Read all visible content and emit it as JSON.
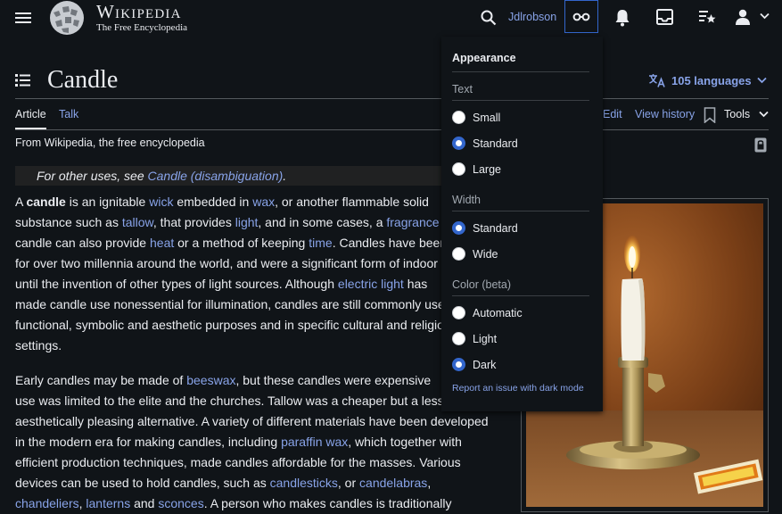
{
  "header": {
    "wordmark_title": "Wikipedia",
    "wordmark_tagline": "The Free Encyclopedia",
    "username": "Jdlrobson"
  },
  "page": {
    "title": "Candle",
    "languages_label": "105 languages",
    "tabs": {
      "article": "Article",
      "talk": "Talk",
      "edit": "Edit",
      "history": "View history",
      "tools": "Tools"
    },
    "tagline": "From Wikipedia, the free encyclopedia",
    "hatnote_prefix": "For other uses, see ",
    "hatnote_link": "Candle (disambiguation)",
    "hatnote_suffix": "."
  },
  "para1": {
    "l1a": "A ",
    "l1b": "candle",
    "l1c": " is an ignitable ",
    "l1d": "wick",
    "l1e": " embedded in ",
    "l1f": "wax",
    "l1g": ", or another flammable solid",
    "l2a": "substance such as ",
    "l2b": "tallow",
    "l2c": ", that provides ",
    "l2d": "light",
    "l2e": ", and in some cases, a ",
    "l2f": "fragrance",
    "l3a": "candle can also provide ",
    "l3b": "heat",
    "l3c": " or a method of keeping ",
    "l3d": "time",
    "l3e": ". Candles have been",
    "l4": "for over two millennia around the world, and were a significant form of indoor",
    "l5a": "until the invention of other types of light sources. Although ",
    "l5b": "electric light",
    "l5c": " has",
    "l6": "made candle use nonessential for illumination, candles are still commonly used",
    "l7": "functional, symbolic and aesthetic purposes and in specific cultural and religious",
    "l8": "settings."
  },
  "para2": {
    "l1a": "Early candles may be made of ",
    "l1b": "beeswax",
    "l1c": ", but these candles were expensive",
    "l2": "use was limited to the elite and the churches. Tallow was a cheaper but a less",
    "l3": "aesthetically pleasing alternative. A variety of different materials have been developed",
    "l4a": "in the modern era for making candles, including ",
    "l4b": "paraffin wax",
    "l4c": ", which together with",
    "l5": "efficient production techniques, made candles affordable for the masses. Various",
    "l6a": "devices can be used to hold candles, such as ",
    "l6b": "candlesticks",
    "l6c": ", or ",
    "l6d": "candelabras",
    "l6e": ",",
    "l7a": "chandeliers",
    "l7b": ", ",
    "l7c": "lanterns",
    "l7d": " and ",
    "l7e": "sconces",
    "l7f": ". A person who makes candles is traditionally"
  },
  "appearance": {
    "title": "Appearance",
    "text_label": "Text",
    "text_options": [
      "Small",
      "Standard",
      "Large"
    ],
    "text_selected": "Standard",
    "width_label": "Width",
    "width_options": [
      "Standard",
      "Wide"
    ],
    "width_selected": "Standard",
    "color_label": "Color (beta)",
    "color_options": [
      "Automatic",
      "Light",
      "Dark"
    ],
    "color_selected": "Dark",
    "report_link": "Report an issue with dark mode"
  },
  "colors": {
    "link": "#88a3e8",
    "accent": "#3366cc",
    "background": "#101418",
    "text": "#eaecf0"
  }
}
